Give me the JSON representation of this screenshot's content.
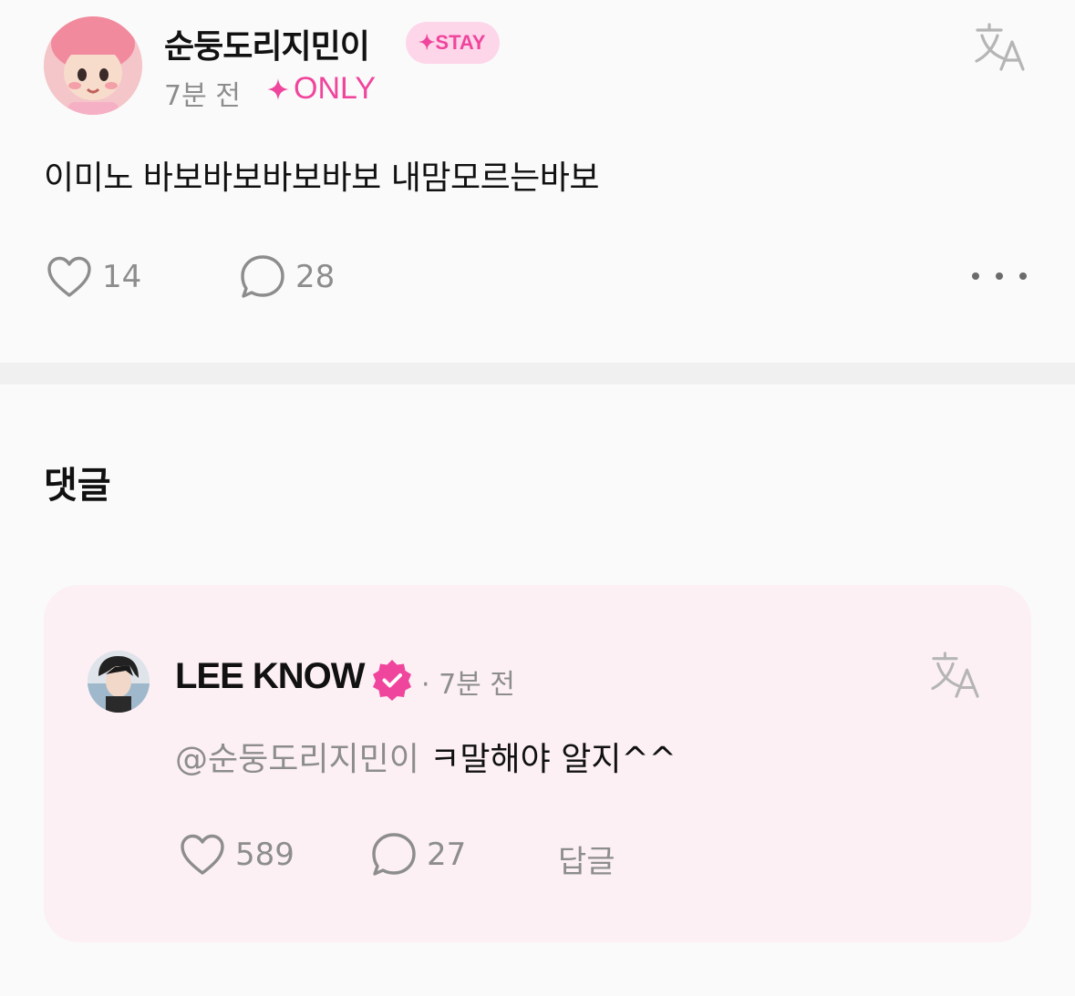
{
  "post": {
    "author": "순둥도리지민이",
    "badge": "✦STAY",
    "time": "7분 전",
    "audience": "ONLY",
    "text": "이미노 바보바보바보바보 내맘모르는바보",
    "likes": "14",
    "comments": "28",
    "translate_icon": "translate-icon",
    "more_icon": "more-dots-icon"
  },
  "comments_section": {
    "title": "댓글"
  },
  "comment": {
    "author": "LEE KNOW",
    "time": "· 7분 전",
    "mention": "@순둥도리지민이",
    "text": "ㅋ말해야 알지^^",
    "likes": "589",
    "replies": "27",
    "reply_label": "답글",
    "verified_icon": "verified-badge-icon"
  },
  "colors": {
    "accent_pink": "#f0459d",
    "badge_bg": "#fdd6ea",
    "comment_bg": "#fcf0f4",
    "muted_text": "#8d8d8d",
    "page_bg": "#fafafa"
  }
}
